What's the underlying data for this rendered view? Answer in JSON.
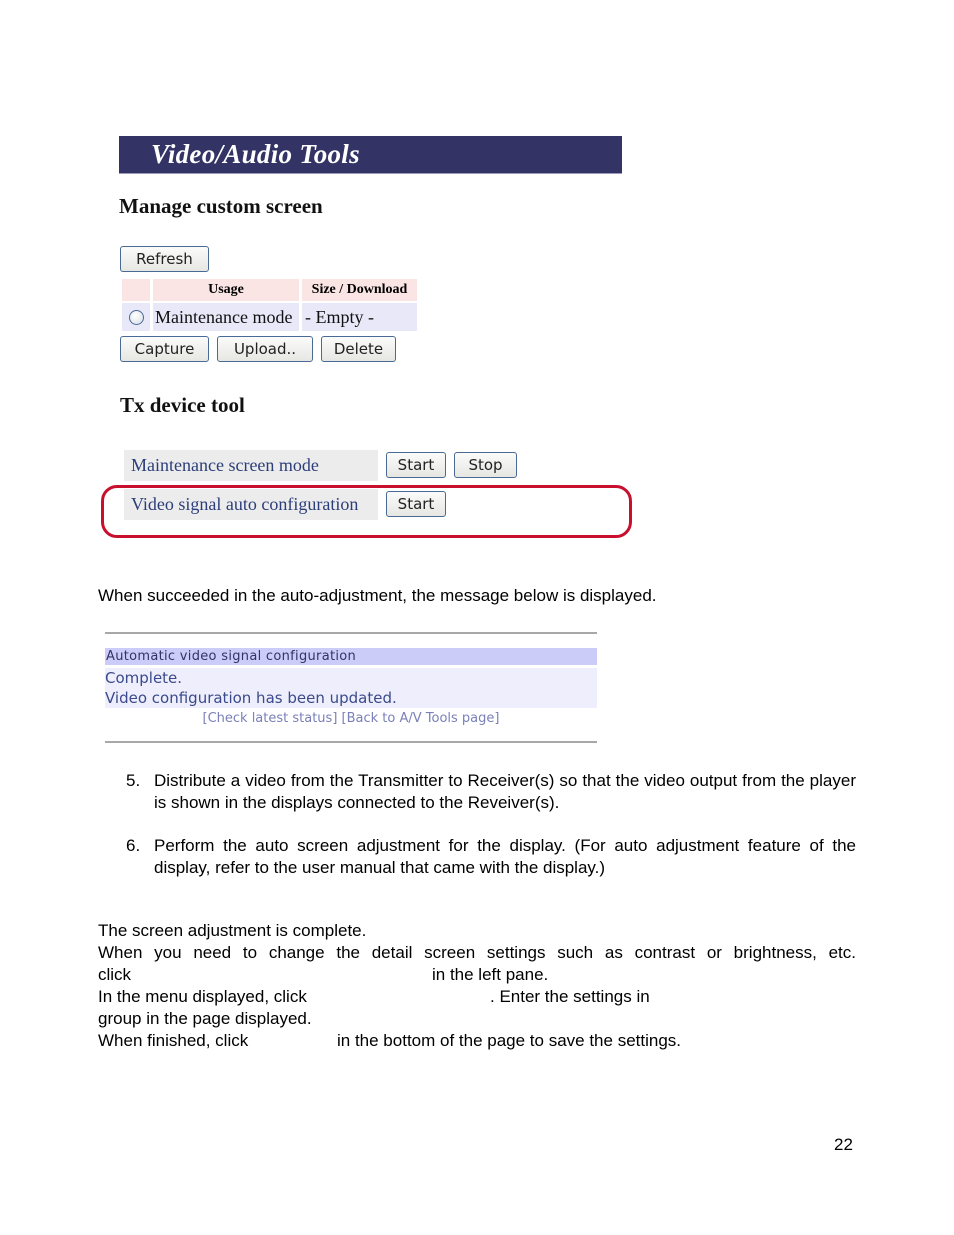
{
  "screenshot_tools": {
    "banner_title": "Video/Audio Tools",
    "manage_section": {
      "heading": "Manage custom screen",
      "refresh_button": "Refresh",
      "table": {
        "columns": [
          "",
          "Usage",
          "Size / Download"
        ],
        "rows": [
          {
            "selected": false,
            "usage": "Maintenance mode",
            "size": "- Empty -"
          }
        ]
      },
      "capture_button": "Capture",
      "upload_button": "Upload..",
      "delete_button": "Delete"
    },
    "tx_section": {
      "heading": "Tx device tool",
      "rows": [
        {
          "label": "Maintenance screen mode",
          "start_button": "Start",
          "stop_button": "Stop"
        },
        {
          "label": "Video signal auto configuration",
          "start_button": "Start",
          "highlighted": true
        }
      ],
      "highlight_color": "#c8102e"
    }
  },
  "intro_text": "When succeeded in the auto-adjustment, the message below is displayed.",
  "screenshot_message": {
    "title": "Automatic video signal configuration",
    "body_lines": [
      "Complete.",
      "Video configuration has been updated."
    ],
    "links": [
      "[Check latest status]",
      "[Back to A/V Tools page]"
    ]
  },
  "steps": [
    {
      "number": "5.",
      "text": "Distribute a video from the Transmitter to Receiver(s) so that the video output from the player is shown in the displays connected to the Reveiver(s)."
    },
    {
      "number": "6.",
      "text": "Perform the auto screen adjustment for the display.  (For auto adjustment feature of the display, refer to the user manual that came with the display.)"
    }
  ],
  "closing": {
    "line1": "The screen adjustment is complete.",
    "line2": "When you need to change the detail screen settings such as contrast or brightness, etc.",
    "line3a": "click",
    "line3b": "in the left pane.",
    "line4a": "In the menu displayed, click",
    "line4b": ".  Enter the settings in",
    "line5": "group in the page displayed.",
    "line6a": "When finished, click",
    "line6b": "in the bottom of the page to save the settings."
  },
  "page_number": "22"
}
